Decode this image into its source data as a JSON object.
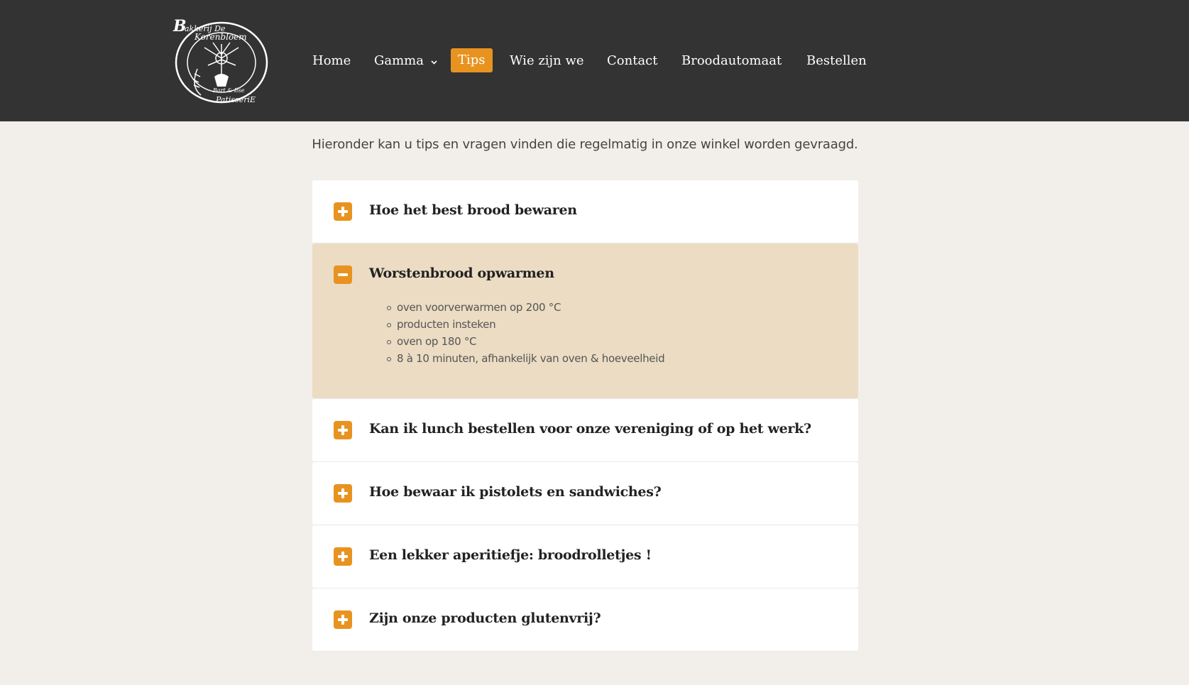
{
  "header": {
    "logo_text": "Bakkerij De Korenbloem Patisserie",
    "nav": [
      {
        "label": "Home",
        "active": false
      },
      {
        "label": "Gamma",
        "active": false,
        "has_dropdown": true
      },
      {
        "label": "Tips",
        "active": true
      },
      {
        "label": "Wie zijn we",
        "active": false
      },
      {
        "label": "Contact",
        "active": false
      },
      {
        "label": "Broodautomaat",
        "active": false
      },
      {
        "label": "Bestellen",
        "active": false
      }
    ]
  },
  "intro": "Hieronder kan u tips en vragen vinden die regelmatig in onze winkel worden gevraagd.",
  "accordion": [
    {
      "title": "Hoe het best brood bewaren",
      "open": false
    },
    {
      "title": "Worstenbrood opwarmen",
      "open": true,
      "items": [
        "oven voorverwarmen op 200 °C",
        "producten insteken",
        "oven op 180 °C",
        "8 à 10 minuten, afhankelijk van oven & hoeveelheid"
      ]
    },
    {
      "title": "Kan ik lunch bestellen voor onze vereniging of op het werk?",
      "open": false
    },
    {
      "title": "Hoe bewaar ik pistolets en sandwiches?",
      "open": false
    },
    {
      "title": "Een lekker aperitiefje: broodrolletjes !",
      "open": false
    },
    {
      "title": "Zijn onze producten glutenvrij?",
      "open": false
    }
  ],
  "colors": {
    "header_bg": "#333333",
    "accent": "#e8931f",
    "page_bg": "#f2efea",
    "open_panel_bg": "#ebdcc3"
  },
  "icons": {
    "collapsed": "plus-square-icon",
    "expanded": "minus-square-icon"
  }
}
